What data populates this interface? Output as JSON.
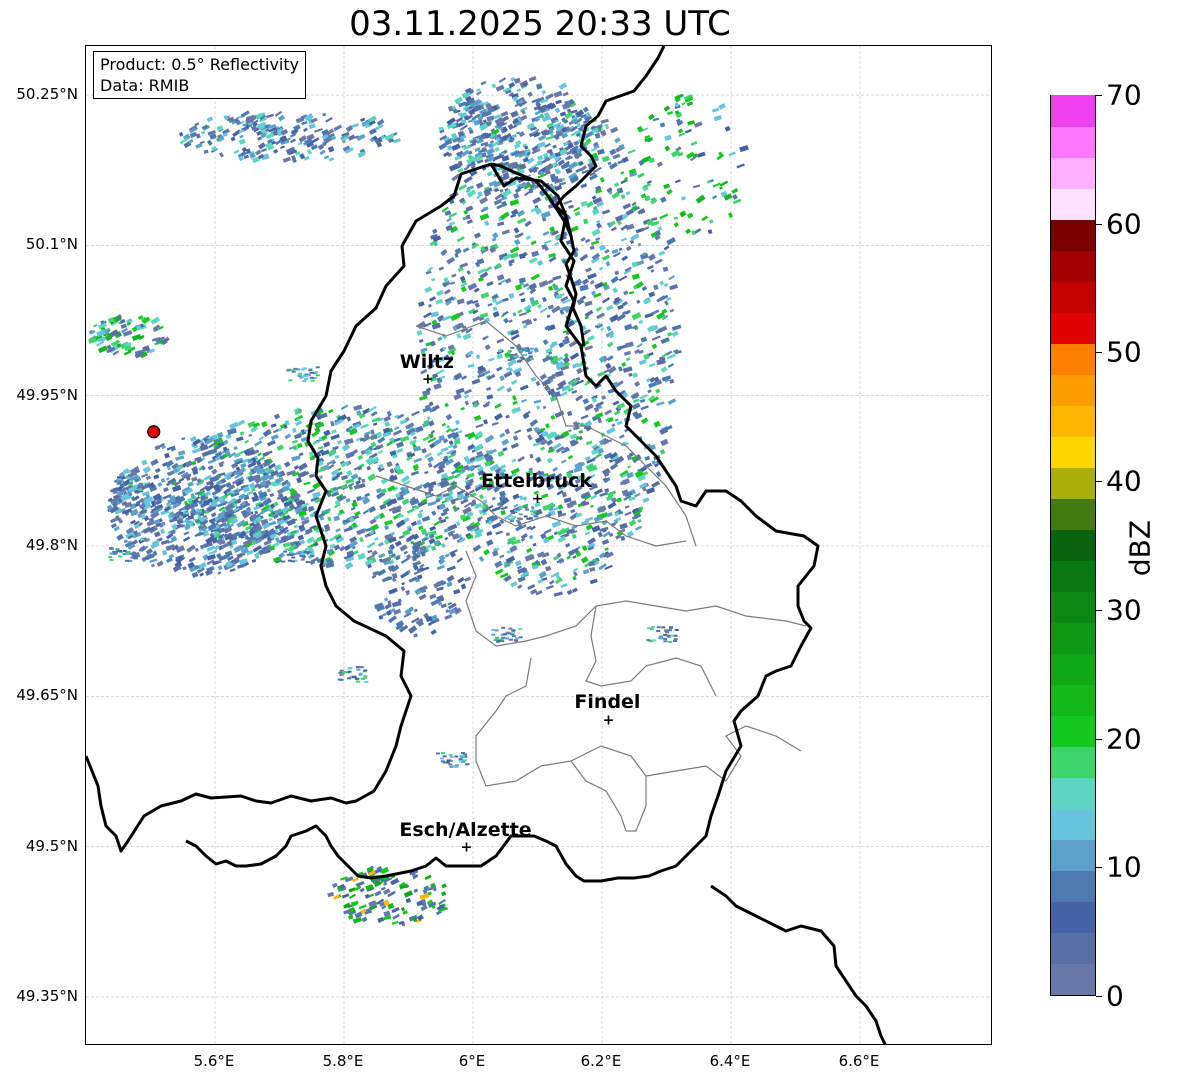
{
  "title": "03.11.2025 20:33 UTC",
  "info_box": {
    "product": "Product: 0.5° Reflectivity",
    "data": "Data: RMIB"
  },
  "map": {
    "lat_labels": [
      {
        "value": 50.25,
        "label": "50.25°N"
      },
      {
        "value": 50.1,
        "label": "50.1°N"
      },
      {
        "value": 49.95,
        "label": "49.95°N"
      },
      {
        "value": 49.8,
        "label": "49.8°N"
      },
      {
        "value": 49.65,
        "label": "49.65°N"
      },
      {
        "value": 49.5,
        "label": "49.5°N"
      },
      {
        "value": 49.35,
        "label": "49.35°N"
      }
    ],
    "lon_labels": [
      {
        "value": 5.6,
        "label": "5.6°E"
      },
      {
        "value": 5.8,
        "label": "5.8°E"
      },
      {
        "value": 6.0,
        "label": "6°E"
      },
      {
        "value": 6.2,
        "label": "6.2°E"
      },
      {
        "value": 6.4,
        "label": "6.4°E"
      },
      {
        "value": 6.6,
        "label": "6.6°E"
      }
    ],
    "cities": [
      {
        "name": "Wiltz",
        "lon": 5.93,
        "lat": 49.967
      },
      {
        "name": "Ettelbruck",
        "lon": 6.1,
        "lat": 49.848
      },
      {
        "name": "Findel",
        "lon": 6.21,
        "lat": 49.627
      },
      {
        "name": "Esch/Alzette",
        "lon": 5.99,
        "lat": 49.5
      }
    ],
    "radar_site": {
      "lon": 5.505,
      "lat": 49.914
    },
    "grid": true
  },
  "colorbar": {
    "label": "dBZ",
    "ticks": [
      {
        "value": 0,
        "label": "0"
      },
      {
        "value": 10,
        "label": "10"
      },
      {
        "value": 20,
        "label": "20"
      },
      {
        "value": 30,
        "label": "30"
      },
      {
        "value": 40,
        "label": "40"
      },
      {
        "value": 50,
        "label": "50"
      },
      {
        "value": 60,
        "label": "60"
      },
      {
        "value": 70,
        "label": "70"
      }
    ],
    "range": [
      0,
      70
    ],
    "colors": [
      "#6878a8",
      "#5a6ea6",
      "#4662a4",
      "#4c7ab0",
      "#5aa0c8",
      "#66c4dc",
      "#5cd6c0",
      "#3ed46c",
      "#14c81e",
      "#12b81a",
      "#10a818",
      "#0e9816",
      "#0c8814",
      "#0a7812",
      "#0a6410",
      "#447a10",
      "#a8b008",
      "#ffd800",
      "#ffb800",
      "#ff9c00",
      "#ff8000",
      "#e00000",
      "#c40000",
      "#a40000",
      "#7a0000",
      "#ffe0ff",
      "#ffb0ff",
      "#ff78ff",
      "#ee40ee"
    ]
  }
}
